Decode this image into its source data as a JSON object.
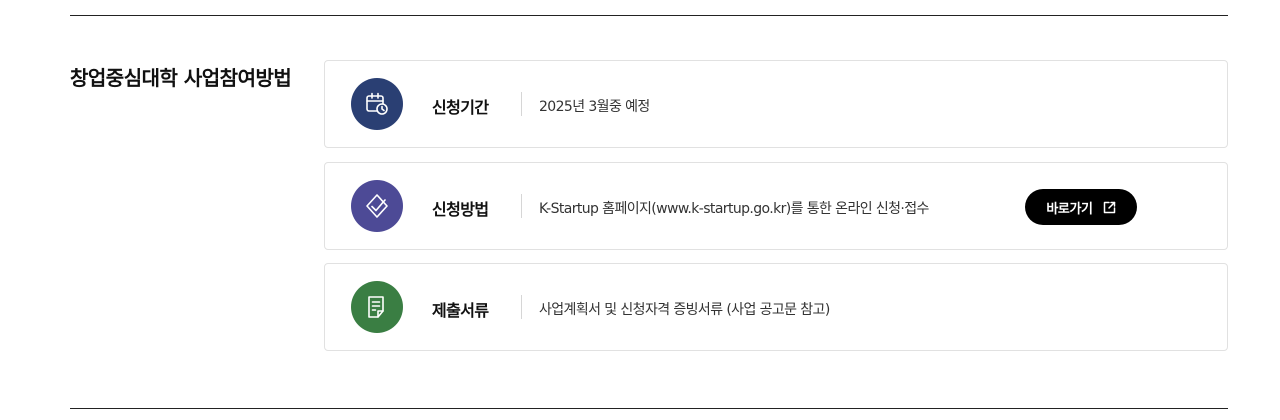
{
  "section": {
    "title": "창업중심대학 사업참여방법"
  },
  "steps": [
    {
      "icon": "calendar-clock-icon",
      "label": "신청기간",
      "description": "2025년 3월중 예정",
      "color": "#2a3f73"
    },
    {
      "icon": "check-badge-icon",
      "label": "신청방법",
      "description": "K-Startup 홈페이지(www.k-startup.go.kr)를 통한 온라인 신청·접수",
      "color": "#4d4a96",
      "button": {
        "label": "바로가기",
        "icon": "external-link-icon",
        "color": "#000000"
      }
    },
    {
      "icon": "document-icon",
      "label": "제출서류",
      "description": "사업계획서 및 신청자격 증빙서류 (사업 공고문 참고)",
      "color": "#3a7e43"
    }
  ]
}
